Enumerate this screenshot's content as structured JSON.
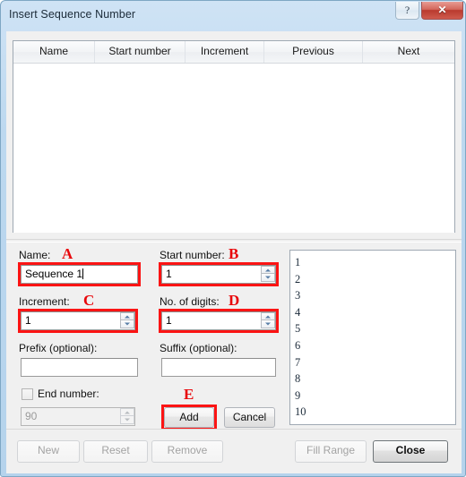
{
  "window": {
    "title": "Insert Sequence Number",
    "help_label": "?",
    "close_label": "✕"
  },
  "listview": {
    "columns": [
      "Name",
      "Start number",
      "Increment",
      "Previous",
      "Next"
    ],
    "rows": []
  },
  "form": {
    "name_label": "Name:",
    "name_annotation": "A",
    "name_value": "Sequence 1",
    "start_number_label": "Start number:",
    "start_number_annotation": "B",
    "start_number_value": "1",
    "increment_label": "Increment:",
    "increment_annotation": "C",
    "increment_value": "1",
    "digits_label": "No. of digits:",
    "digits_annotation": "D",
    "digits_value": "1",
    "prefix_label": "Prefix (optional):",
    "prefix_value": "",
    "suffix_label": "Suffix (optional):",
    "suffix_value": "",
    "end_number_label": "End number:",
    "end_number_value": "90",
    "end_number_checked": false,
    "add_label": "Add",
    "add_annotation": "E",
    "cancel_label": "Cancel"
  },
  "preview": {
    "items": [
      "1",
      "2",
      "3",
      "4",
      "5",
      "6",
      "7",
      "8",
      "9",
      "10"
    ]
  },
  "bottom": {
    "new_label": "New",
    "reset_label": "Reset",
    "remove_label": "Remove",
    "fill_range_label": "Fill Range",
    "close_label": "Close"
  },
  "colors": {
    "annotation": "#e8060a",
    "highlight_box": "#fb1414",
    "close_button": "#b93a2e"
  }
}
